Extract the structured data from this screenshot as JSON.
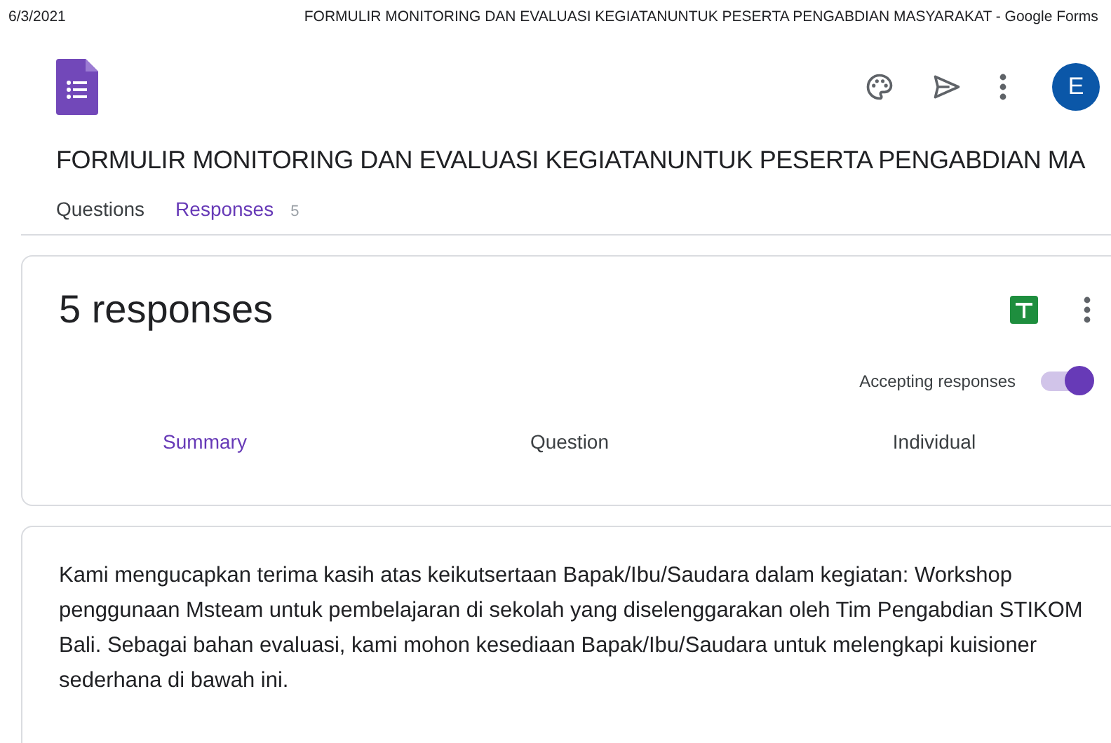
{
  "print_header": {
    "date": "6/3/2021",
    "page_title": "FORMULIR MONITORING DAN EVALUASI KEGIATANUNTUK PESERTA PENGABDIAN MASYARAKAT - Google Forms"
  },
  "toolbar": {
    "avatar": "E"
  },
  "form_title": "FORMULIR MONITORING DAN EVALUASI KEGIATANUNTUK PESERTA PENGABDIAN MA",
  "tabs": [
    {
      "label": "Questions",
      "selected": false
    },
    {
      "label": "Responses",
      "selected": true,
      "count": "5"
    }
  ],
  "responses_card": {
    "heading": "5 responses",
    "accepting_label": "Accepting responses",
    "accepting": true,
    "views": [
      {
        "label": "Summary",
        "selected": true
      },
      {
        "label": "Question",
        "selected": false
      },
      {
        "label": "Individual",
        "selected": false
      }
    ]
  },
  "description": "Kami mengucapkan terima kasih atas keikutsertaan Bapak/Ibu/Saudara dalam kegiatan: Workshop penggunaan Msteam untuk pembelajaran di sekolah yang diselenggarakan oleh Tim Pengabdian STIKOM Bali. Sebagai bahan evaluasi, kami mohon kesediaan Bapak/Ibu/Saudara untuk melengkapi kuisioner sederhana di bawah ini."
}
